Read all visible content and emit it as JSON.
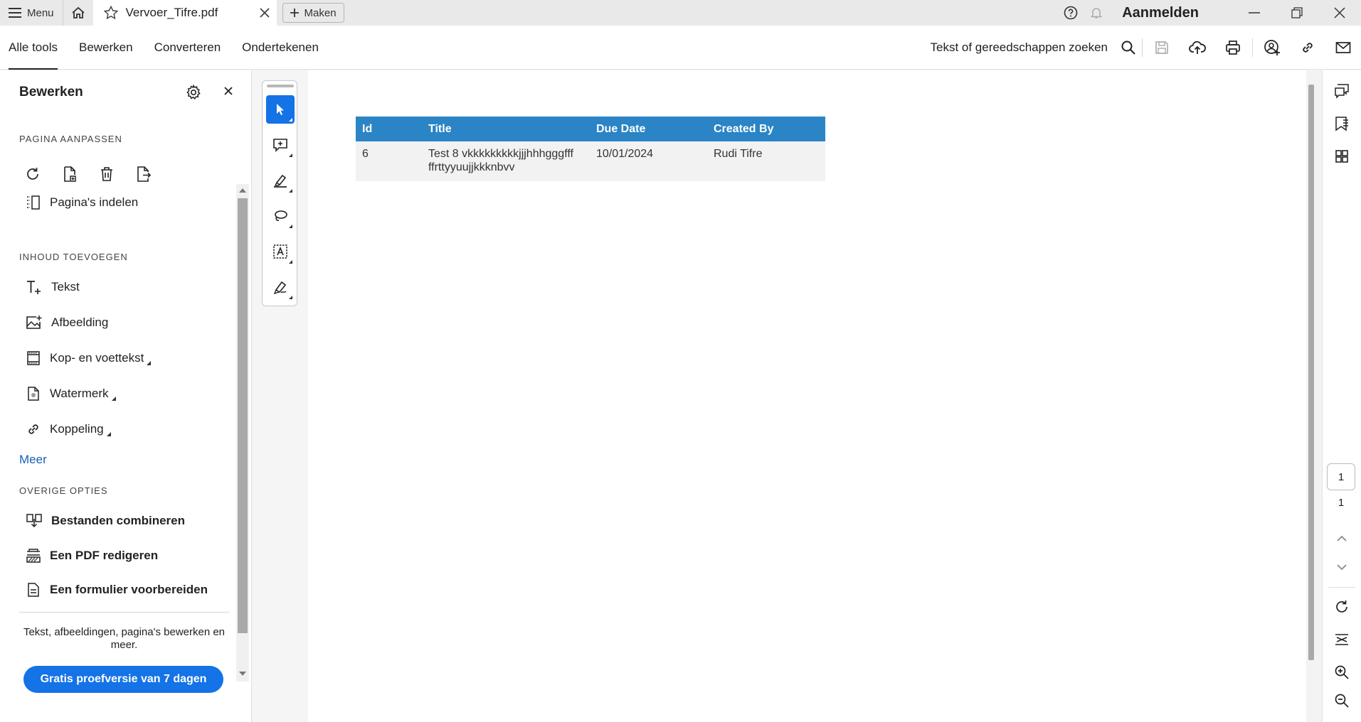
{
  "titlebar": {
    "menu_label": "Menu",
    "tab_title": "Vervoer_Tifre.pdf",
    "create_label": "Maken",
    "signin_label": "Aanmelden"
  },
  "menubar": {
    "tabs": [
      "Alle tools",
      "Bewerken",
      "Converteren",
      "Ondertekenen"
    ],
    "search_label": "Tekst of gereedschappen zoeken"
  },
  "left_panel": {
    "title": "Bewerken",
    "section_page": "PAGINA AANPASSEN",
    "organize_pages": "Pagina's indelen",
    "section_content": "INHOUD TOEVOEGEN",
    "items": [
      "Tekst",
      "Afbeelding",
      "Kop- en voettekst",
      "Watermerk",
      "Koppeling"
    ],
    "more": "Meer",
    "section_other": "OVERIGE OPTIES",
    "other_items": [
      "Bestanden combineren",
      "Een PDF redigeren",
      "Een formulier voorbereiden"
    ],
    "description": "Tekst, afbeeldingen, pagina's bewerken en meer.",
    "trial_button": "Gratis proefversie van 7 dagen"
  },
  "document": {
    "table": {
      "headers": [
        "Id",
        "Title",
        "Due Date",
        "Created By"
      ],
      "rows": [
        [
          "6",
          "Test 8 vkkkkkkkkkjjjhhhgggfff ffrttyyuujjkkknbvv",
          "10/01/2024",
          "Rudi Tifre"
        ]
      ]
    }
  },
  "page_nav": {
    "current_page": "1",
    "total_pages": "1"
  },
  "colors": {
    "accent": "#1473e6",
    "table_header": "#2a84c5",
    "link": "#1a5fb4"
  }
}
